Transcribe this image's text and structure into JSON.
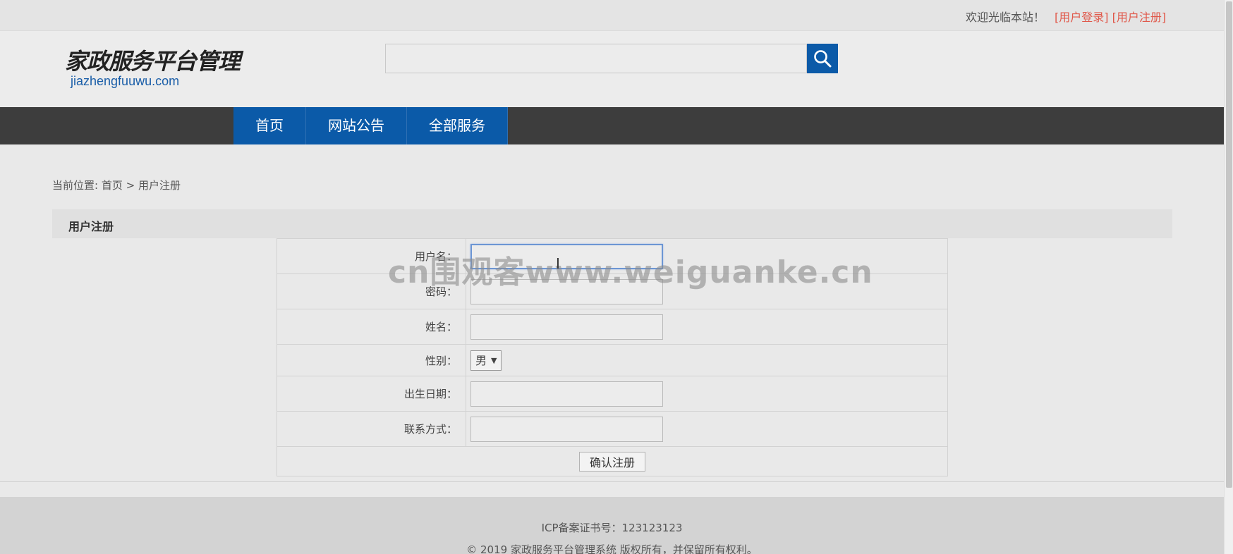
{
  "topbar": {
    "welcome": "欢迎光临本站！",
    "login_link": "[用户登录]",
    "register_link": "[用户注册]"
  },
  "header": {
    "logo_cn": "家政服务平台管理",
    "logo_en": "jiazhengfuuwu.com",
    "search_value": "",
    "search_icon": "search-icon"
  },
  "nav": {
    "items": [
      {
        "label": "首页"
      },
      {
        "label": "网站公告"
      },
      {
        "label": "全部服务"
      }
    ]
  },
  "breadcrumb": {
    "prefix": "当前位置:",
    "home": "首页",
    "separator": ">",
    "current": "用户注册"
  },
  "section": {
    "title": "用户注册"
  },
  "form": {
    "fields": [
      {
        "label": "用户名：",
        "value": ""
      },
      {
        "label": "密码：",
        "value": ""
      },
      {
        "label": "姓名：",
        "value": ""
      },
      {
        "label": "性别：",
        "value": "男"
      },
      {
        "label": "出生日期：",
        "value": ""
      },
      {
        "label": "联系方式：",
        "value": ""
      }
    ],
    "submit_label": "确认注册"
  },
  "watermark": "cn围观客www.weiguanke.cn",
  "footer": {
    "icp": "ICP备案证书号：123123123",
    "copyright": "© 2019 家政服务平台管理系统 版权所有，并保留所有权利。"
  },
  "colors": {
    "brand_blue": "#0b5aa8",
    "nav_dark": "#3d3d3d",
    "link_red": "#e0584a"
  }
}
